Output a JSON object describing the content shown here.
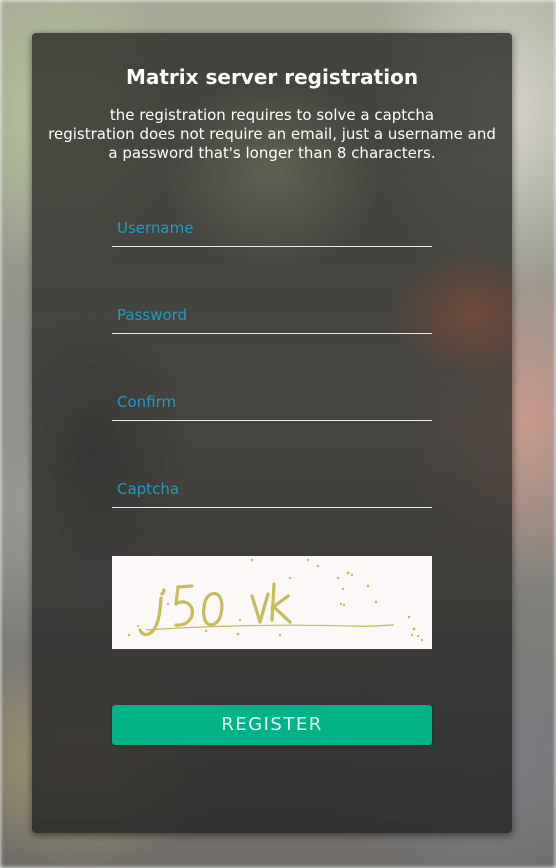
{
  "page": {
    "title": "Matrix server registration",
    "description_lines": [
      "the registration requires to solve a captcha",
      "registration does not require an email, just a username and",
      "a password that's longer than 8 characters."
    ]
  },
  "form": {
    "username_placeholder": "Username",
    "password_placeholder": "Password",
    "confirm_placeholder": "Confirm",
    "captcha_placeholder": "Captcha",
    "captcha_image_text": "j50 vk",
    "register_label": "REGISTER"
  },
  "colors": {
    "accent": "#00b386",
    "placeholder": "#1e9bc4",
    "card_bg": "#2d2d2a",
    "captcha_ink": "#c8bb5a"
  }
}
